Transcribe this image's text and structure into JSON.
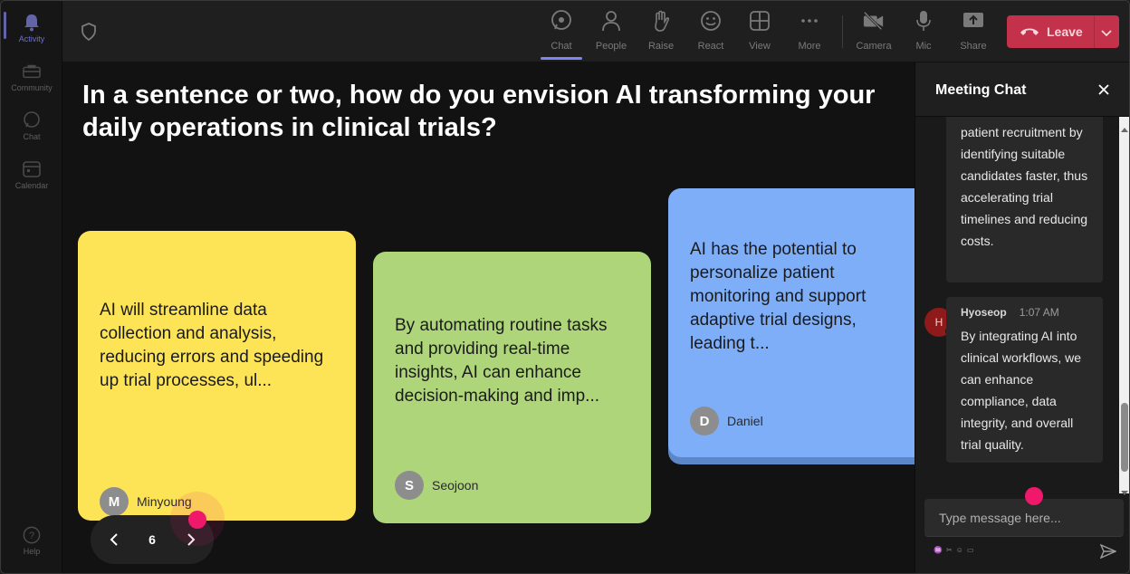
{
  "rail": {
    "items": [
      {
        "label": "Activity",
        "icon": "bell-icon"
      },
      {
        "label": "Community",
        "icon": "community-icon"
      },
      {
        "label": "Chat",
        "icon": "chat-icon"
      },
      {
        "label": "Calendar",
        "icon": "calendar-icon"
      }
    ],
    "help_label": "Help"
  },
  "toolbar": {
    "chat": "Chat",
    "people": "People",
    "raise": "Raise",
    "react": "React",
    "view": "View",
    "more": "More",
    "camera": "Camera",
    "mic": "Mic",
    "share": "Share",
    "leave": "Leave"
  },
  "stage": {
    "question": "In a sentence or two, how do you envision AI transforming your\ndaily operations in clinical trials?",
    "notes": [
      {
        "text": "AI will streamline data collection and analysis, reducing errors and speeding up trial processes, ul...",
        "author": "Minyoung",
        "initial": "M",
        "color": "#fde457"
      },
      {
        "text": "By automating routine tasks and providing real-time insights, AI can enhance decision-making and imp...",
        "author": "Seojoon",
        "initial": "S",
        "color": "#afd57a"
      },
      {
        "text": "AI has the potential to personalize patient monitoring and support adaptive trial designs, leading t...",
        "author": "Daniel",
        "initial": "D",
        "color": "#7eaef8"
      }
    ],
    "page": "6"
  },
  "chat": {
    "title": "Meeting Chat",
    "msg1_text": "patient recruitment by identifying suitable candidates faster, thus accelerating trial timelines and reducing costs.",
    "msg2_name": "Hyoseop",
    "msg2_time": "1:07 AM",
    "msg2_initial": "H",
    "msg2_text": "By integrating AI into clinical workflows, we can enhance compliance, data integrity, and overall trial quality.",
    "input_placeholder": "Type message here...",
    "tools": [
      "♒",
      "✂",
      "☺",
      "▭"
    ]
  },
  "colors": {
    "accent": "#6264a7",
    "leave": "#c4314b",
    "pointer": "#f0186a"
  }
}
